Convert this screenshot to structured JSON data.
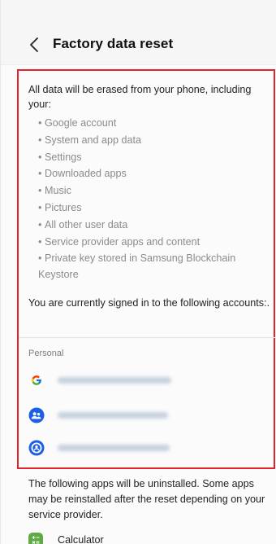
{
  "header": {
    "title": "Factory data reset",
    "back_icon": "chevron-left-icon"
  },
  "intro": "All data will be erased from your phone, including your:",
  "erase_items": [
    "Google account",
    "System and app data",
    "Settings",
    "Downloaded apps",
    "Music",
    "Pictures",
    "All other user data",
    "Service provider apps and content",
    "Private key stored in Samsung Blockchain Keystore"
  ],
  "bullet_glyph": "•",
  "signed_in_text": "You are currently signed in to the following accounts:.",
  "accounts_section_label": "Personal",
  "accounts": [
    {
      "icon": "google-icon"
    },
    {
      "icon": "samsung-people-icon"
    },
    {
      "icon": "samsung-account-icon"
    }
  ],
  "uninstall_text": "The following apps will be uninstalled. Some apps may be reinstalled after the reset depending on your service provider.",
  "apps": [
    {
      "name": "Calculator",
      "icon": "calculator-icon"
    }
  ],
  "colors": {
    "highlight_border": "#e3242b",
    "bullet_text": "#8b8b8b",
    "samsung_blue": "#1a5fe6",
    "calculator_green": "#5faa45"
  }
}
